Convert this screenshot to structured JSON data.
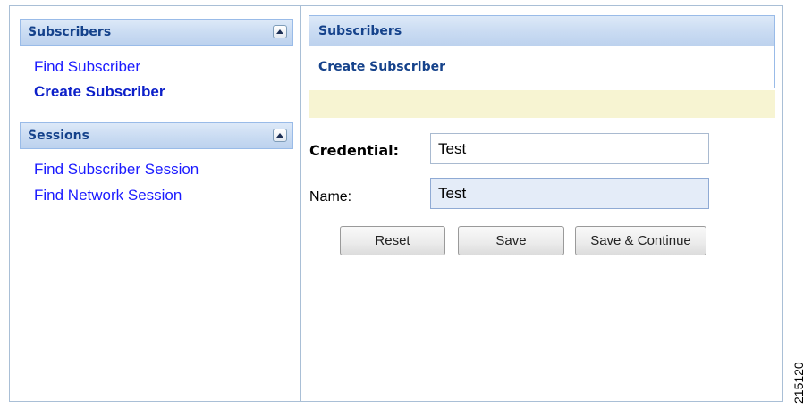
{
  "sidebar": {
    "subscribers": {
      "title": "Subscribers",
      "items": [
        "Find Subscriber",
        "Create Subscriber"
      ]
    },
    "sessions": {
      "title": "Sessions",
      "items": [
        "Find Subscriber Session",
        "Find Network Session"
      ]
    },
    "active_item": "Create Subscriber"
  },
  "main": {
    "header_title": "Subscribers",
    "sub_title": "Create Subscriber",
    "form": {
      "credential_label": "Credential:",
      "credential_value": "Test",
      "name_label": "Name:",
      "name_value": "Test"
    },
    "buttons": {
      "reset": "Reset",
      "save": "Save",
      "save_continue": "Save & Continue"
    }
  },
  "figure_id": "215120",
  "colors": {
    "header_text": "#15428b",
    "link": "#1a1aff",
    "notice_bg": "#f7f4d2",
    "border": "#99bbe8"
  },
  "icons": {
    "collapse": "chevron-up-icon"
  }
}
